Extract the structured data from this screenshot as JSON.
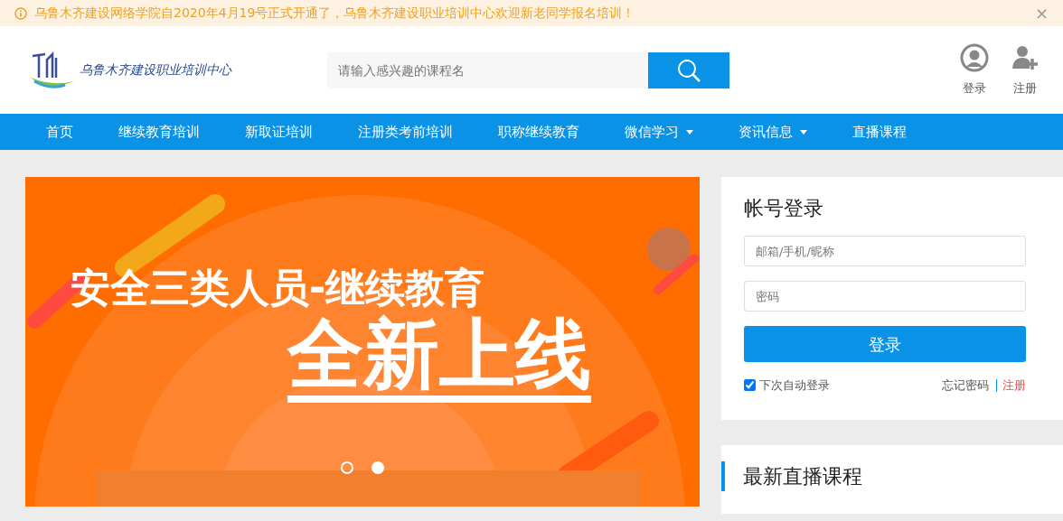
{
  "notice": {
    "text": "乌鲁木齐建设网络学院自2020年4月19号正式开通了，乌鲁木齐建设职业培训中心欢迎新老同学报名培训！",
    "close": "×"
  },
  "header": {
    "logo_text": "乌鲁木齐建设职业培训中心",
    "search": {
      "placeholder": "请输入感兴趣的课程名"
    },
    "actions": [
      {
        "kind": "login",
        "label": "登录"
      },
      {
        "kind": "register",
        "label": "注册"
      }
    ]
  },
  "nav": [
    {
      "label": "首页",
      "dropdown": false
    },
    {
      "label": "继续教育培训",
      "dropdown": false
    },
    {
      "label": "新取证培训",
      "dropdown": false
    },
    {
      "label": "注册类考前培训",
      "dropdown": false
    },
    {
      "label": "职称继续教育",
      "dropdown": false
    },
    {
      "label": "微信学习",
      "dropdown": true
    },
    {
      "label": "资讯信息",
      "dropdown": true
    },
    {
      "label": "直播课程",
      "dropdown": false
    }
  ],
  "banner": {
    "headline": "安全三类人员-继续教育",
    "subheadline": "全新上线",
    "dots": [
      {
        "selected": false
      },
      {
        "selected": true
      }
    ]
  },
  "login": {
    "title": "帐号登录",
    "username": {
      "placeholder": "邮箱/手机/昵称"
    },
    "password": {
      "placeholder": "密码"
    },
    "submit": "登录",
    "remember": {
      "label": "下次自动登录",
      "checked": true
    },
    "forgot": "忘记密码",
    "register": "注册"
  },
  "live": {
    "title": "最新直播课程"
  }
}
